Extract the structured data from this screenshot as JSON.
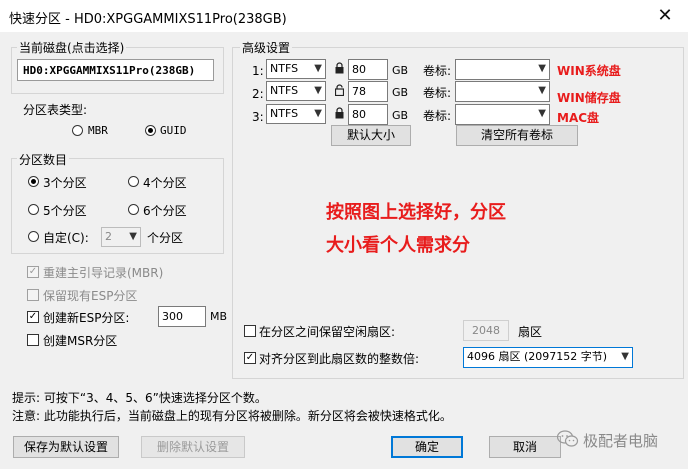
{
  "window": {
    "title": "快速分区 - HD0:XPGGAMMIXS11Pro(238GB)",
    "close_glyph": "✕"
  },
  "disk": {
    "label": "当前磁盘(点击选择)",
    "value": "HD0:XPGGAMMIXS11Pro(238GB)"
  },
  "partition_table": {
    "label": "分区表类型:",
    "options": [
      "MBR",
      "GUID"
    ],
    "selected": "GUID"
  },
  "partition_count": {
    "label": "分区数目",
    "options": [
      "3个分区",
      "4个分区",
      "5个分区",
      "6个分区",
      "自定(C):"
    ],
    "selected": "3个分区",
    "custom_value": "2",
    "custom_suffix": "个分区"
  },
  "checks": {
    "rebuild_mbr": {
      "label": "重建主引导记录(MBR)",
      "checked": true,
      "disabled": true
    },
    "keep_esp": {
      "label": "保留现有ESP分区",
      "checked": false,
      "disabled": true
    },
    "create_esp": {
      "label": "创建新ESP分区:",
      "checked": true,
      "value": "300",
      "unit": "MB"
    },
    "create_msr": {
      "label": "创建MSR分区",
      "checked": false
    }
  },
  "advanced": {
    "label": "高级设置",
    "rows": [
      {
        "index": "1:",
        "fs": "NTFS",
        "size": "80",
        "unit": "GB",
        "vol_label": "卷标:",
        "volume": "",
        "locked": true
      },
      {
        "index": "2:",
        "fs": "NTFS",
        "size": "78",
        "unit": "GB",
        "vol_label": "卷标:",
        "volume": "",
        "locked": false
      },
      {
        "index": "3:",
        "fs": "NTFS",
        "size": "80",
        "unit": "GB",
        "vol_label": "卷标:",
        "volume": "",
        "locked": true
      }
    ],
    "default_size_button": "默认大小",
    "clear_labels_button": "清空所有卷标"
  },
  "annotations": {
    "row1": "WIN系统盘",
    "row2": "WIN储存盘",
    "row3": "MAC盘",
    "instruction_line1": "按照图上选择好，分区",
    "instruction_line2": "大小看个人需求分",
    "color": "#e81c1c"
  },
  "sector_options": {
    "keep_free": {
      "label": "在分区之间保留空闲扇区:",
      "checked": false,
      "value": "2048",
      "unit": "扇区"
    },
    "align": {
      "label": "对齐分区到此扇区数的整数倍:",
      "checked": true,
      "value": "4096 扇区 (2097152 字节)"
    }
  },
  "hints": {
    "tip": "提示: 可按下“3、4、5、6”快速选择分区个数。",
    "note": "注意: 此功能执行后，当前磁盘上的现有分区将被删除。新分区将会被快速格式化。"
  },
  "footer": {
    "save_default": "保存为默认设置",
    "delete_default": "删除默认设置",
    "ok": "确定",
    "cancel": "取消",
    "watermark": "极配者电脑"
  }
}
